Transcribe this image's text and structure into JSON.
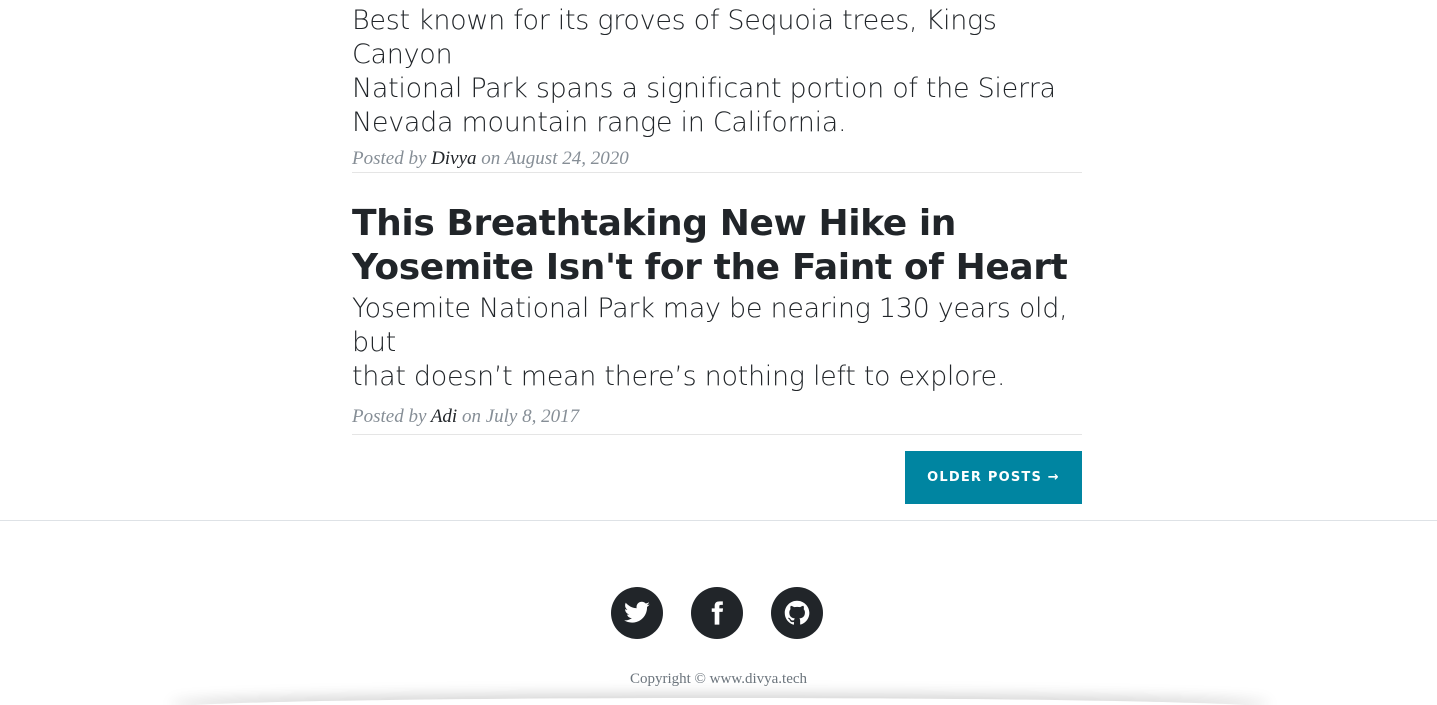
{
  "posts": [
    {
      "subtitle_lines": [
        "Best known for its groves of Sequoia trees, Kings Canyon",
        "National Park spans a significant portion of the Sierra",
        "Nevada mountain range in California."
      ],
      "meta_prefix": "Posted by",
      "author": "Divya",
      "meta_on": "on",
      "date": "August 24, 2020"
    },
    {
      "title_lines": [
        "This Breathtaking New Hike in",
        "Yosemite Isn't for the Faint of Heart"
      ],
      "subtitle_lines": [
        "Yosemite National Park may be nearing 130 years old, but",
        "that doesn’t mean there’s nothing left to explore."
      ],
      "meta_prefix": "Posted by",
      "author": "Adi",
      "meta_on": "on",
      "date": "July 8, 2017"
    }
  ],
  "pager": {
    "older_label": "OLDER POSTS →"
  },
  "footer": {
    "social": [
      "twitter-icon",
      "facebook-icon",
      "github-icon"
    ],
    "copyright": "Copyright © www.divya.tech"
  },
  "colors": {
    "accent": "#0085a1",
    "text": "#212529",
    "meta": "#868e96"
  }
}
